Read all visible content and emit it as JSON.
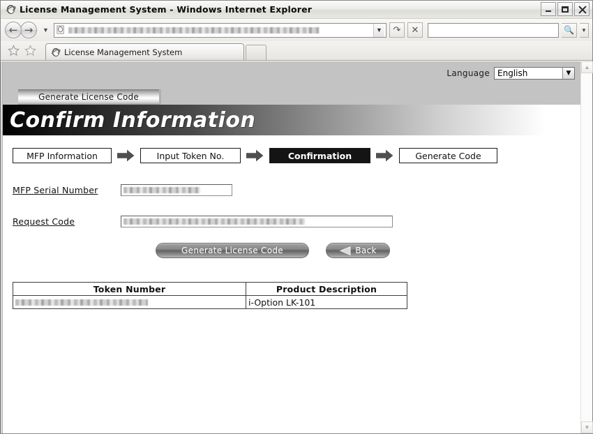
{
  "window": {
    "title": "License Management System - Windows Internet Explorer",
    "icon": "ie-logo-icon",
    "minimize_label": "Minimize",
    "maximize_label": "Maximize",
    "close_label": "Close"
  },
  "navbar": {
    "back_label": "Back",
    "forward_label": "Forward",
    "recent_pages_label": "Recent Pages",
    "address_value": "",
    "address_redacted": true,
    "address_dropdown_label": "Address dropdown",
    "refresh_label": "Refresh",
    "stop_label": "Stop",
    "search_placeholder": "",
    "search_go_label": "Search",
    "search_provider_label": "Search provider"
  },
  "tabbar": {
    "favorites_label": "Favorites Center",
    "add_favorites_label": "Add to Favorites",
    "tabs": [
      {
        "label": "License Management System",
        "icon": "ie-page-icon",
        "active": true
      }
    ],
    "new_tab_label": "New Tab"
  },
  "page": {
    "language": {
      "label": "Language",
      "selected": "English",
      "options": [
        "English"
      ]
    },
    "app_tab": {
      "label": "Generate License Code"
    },
    "banner": {
      "title": "Confirm Information"
    },
    "steps": [
      {
        "label": "MFP Information",
        "active": false
      },
      {
        "label": "Input Token No.",
        "active": false
      },
      {
        "label": "Confirmation",
        "active": true
      },
      {
        "label": "Generate Code",
        "active": false
      }
    ],
    "fields": [
      {
        "label": "MFP Serial Number",
        "value": "",
        "redacted": true
      },
      {
        "label": "Request Code",
        "value": "",
        "redacted": true
      }
    ],
    "buttons": {
      "generate": "Generate License Code",
      "back": "Back",
      "back_icon": "left-arrow-icon"
    },
    "table": {
      "headers": [
        "Token Number",
        "Product Description"
      ],
      "rows": [
        {
          "token_number": "",
          "token_redacted": true,
          "product_description": "i-Option LK-101"
        }
      ]
    }
  },
  "scrollbar": {
    "up_label": "Scroll up",
    "down_label": "Scroll down"
  },
  "colors": {
    "banner_start": "#000000",
    "banner_end": "#ffffff",
    "active_step_bg": "#141414",
    "strip_gray": "#c3c3c3"
  }
}
